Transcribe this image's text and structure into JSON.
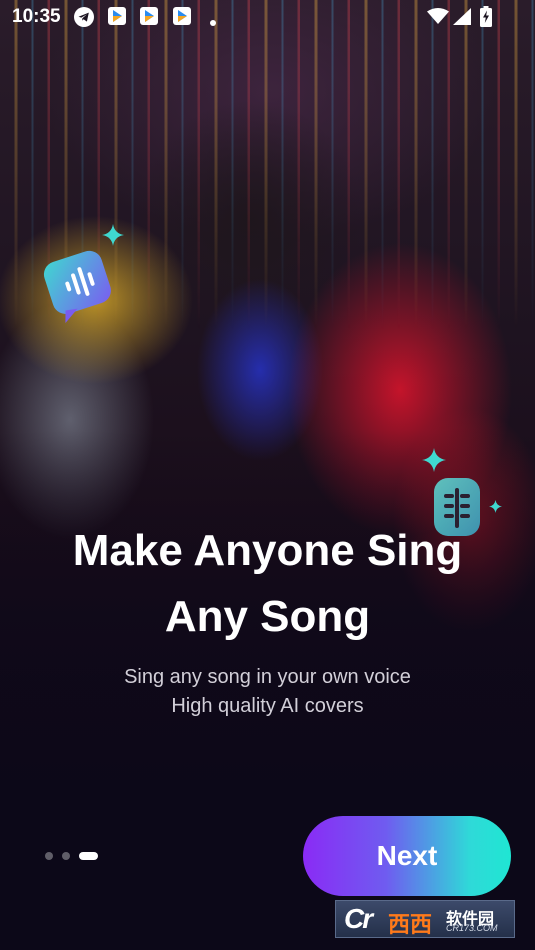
{
  "status_bar": {
    "time": "10:35",
    "icons": [
      "telegram-icon",
      "app-icon",
      "app-icon",
      "app-icon",
      "notification-dot-icon",
      "wifi-icon",
      "signal-icon",
      "battery-charging-icon"
    ]
  },
  "decorations": [
    "audio-wave-chat-icon",
    "sparkle-icon",
    "microphone-icon",
    "sparkle-icon"
  ],
  "onboarding": {
    "headline_line1": "Make Anyone Sing",
    "headline_line2": "Any Song",
    "subtitle_line1": "Sing any song in your own voice",
    "subtitle_line2": "High quality AI covers",
    "page_count": 3,
    "current_page": 3
  },
  "next_button": {
    "label": "Next"
  },
  "watermark": {
    "logo": "Cr",
    "brand": "西西",
    "name": "软件园",
    "domain": "CR173.COM"
  },
  "colors": {
    "button_gradient_start": "#8a2bf5",
    "button_gradient_end": "#1fe6d3",
    "text_primary": "#ffffff",
    "text_secondary": "#d2cfd8"
  }
}
